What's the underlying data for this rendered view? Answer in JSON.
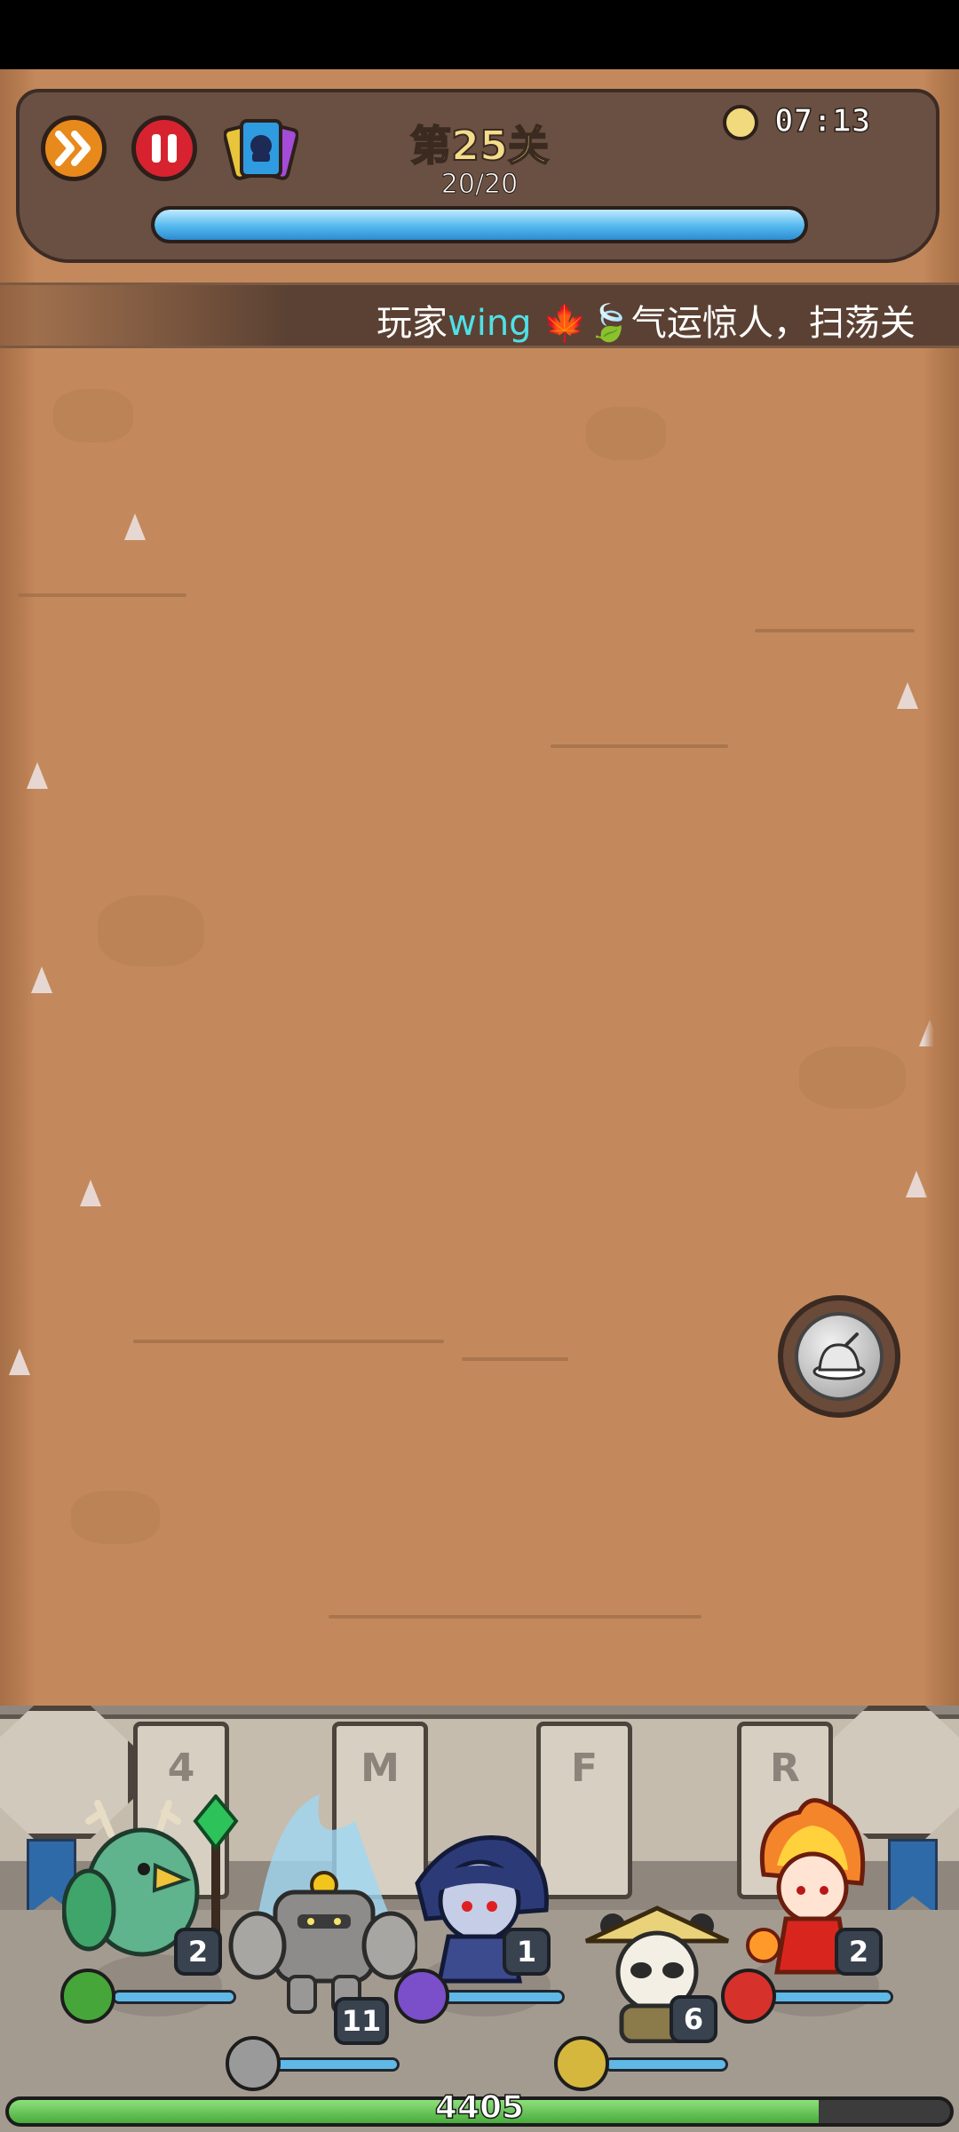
{
  "hud": {
    "level_title": "第25关",
    "wave_count": "20/20",
    "wave_progress": 1.0,
    "timer": "07:13",
    "icons": [
      "fast-forward-icon",
      "pause-icon",
      "cards-icon",
      "clock-icon"
    ]
  },
  "marquee": {
    "prefix": "玩家",
    "player_name": "wing",
    "emojis": "🍁🍃",
    "message": "气运惊人，扫荡关"
  },
  "skill_button": {
    "icon": "roast-dish-icon"
  },
  "base": {
    "pillar_glyphs": [
      "4",
      "M",
      "F",
      "R"
    ]
  },
  "heroes": [
    {
      "name": "green-bird-druid",
      "level": "2",
      "element_icon": "wind-icon",
      "element_color": "#46a63a",
      "hp": 1.0
    },
    {
      "name": "stone-golem",
      "level": "11",
      "element_icon": "rock-icon",
      "element_color": "#9a9a9a",
      "hp": 1.0
    },
    {
      "name": "dark-elf",
      "level": "1",
      "element_icon": "shadow-icon",
      "element_color": "#7a4fc9",
      "hp": 1.0
    },
    {
      "name": "panda-monk",
      "level": "6",
      "element_icon": "earth-icon",
      "element_color": "#d6b73d",
      "hp": 1.0
    },
    {
      "name": "fire-spirit",
      "level": "2",
      "element_icon": "fire-icon",
      "element_color": "#d7312c",
      "hp": 1.0
    }
  ],
  "base_health": {
    "value": "4405",
    "fill": 0.86
  }
}
